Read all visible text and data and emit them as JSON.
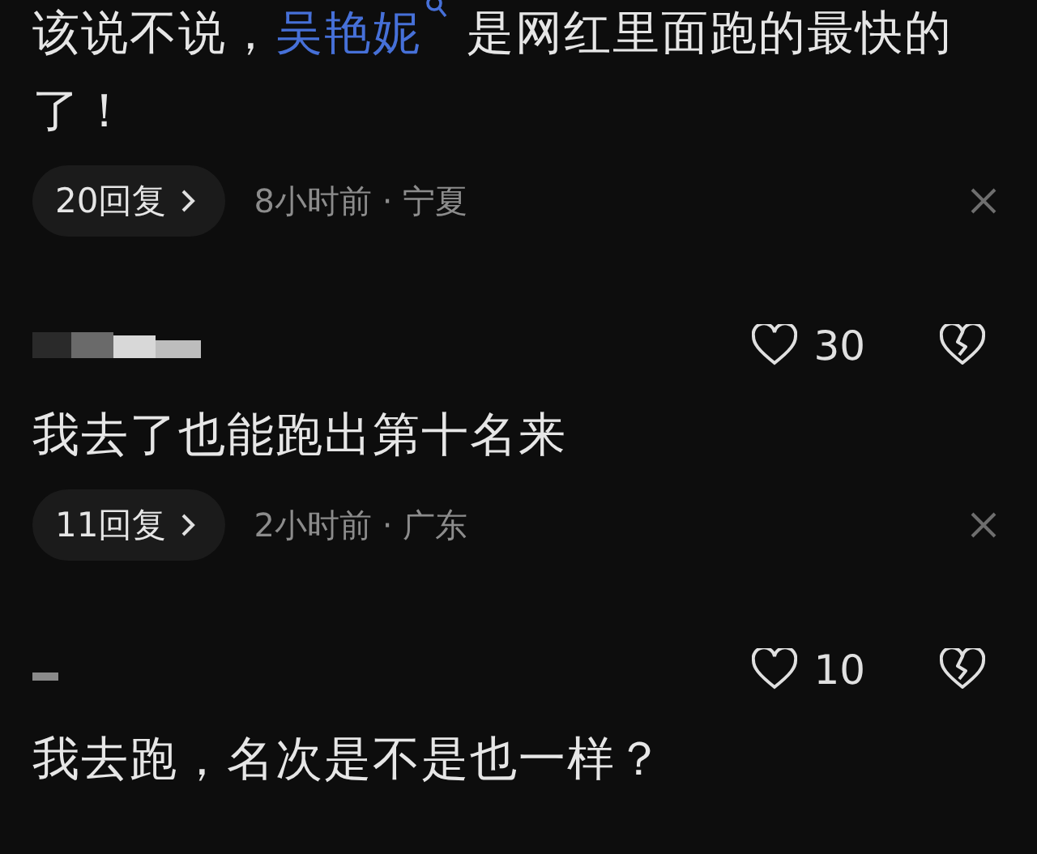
{
  "comments": [
    {
      "segments": [
        {
          "kind": "plain",
          "text": "该说不说，"
        },
        {
          "kind": "mention",
          "text": "吴艳妮"
        },
        {
          "kind": "plain",
          "text": " 是网红里面跑的最快的了！"
        }
      ],
      "replies": "20回复",
      "time": "8小时前 · 宁夏"
    },
    {
      "author": {
        "kind": "blurred"
      },
      "likes": "30",
      "segments": [
        {
          "kind": "plain",
          "text": "我去了也能跑出第十名来"
        }
      ],
      "replies": "11回复",
      "time": "2小时前 · 广东"
    },
    {
      "author": {
        "kind": "hidden"
      },
      "likes": "10",
      "segments": [
        {
          "kind": "plain",
          "text": "我去跑，名次是不是也一样？"
        }
      ]
    }
  ]
}
